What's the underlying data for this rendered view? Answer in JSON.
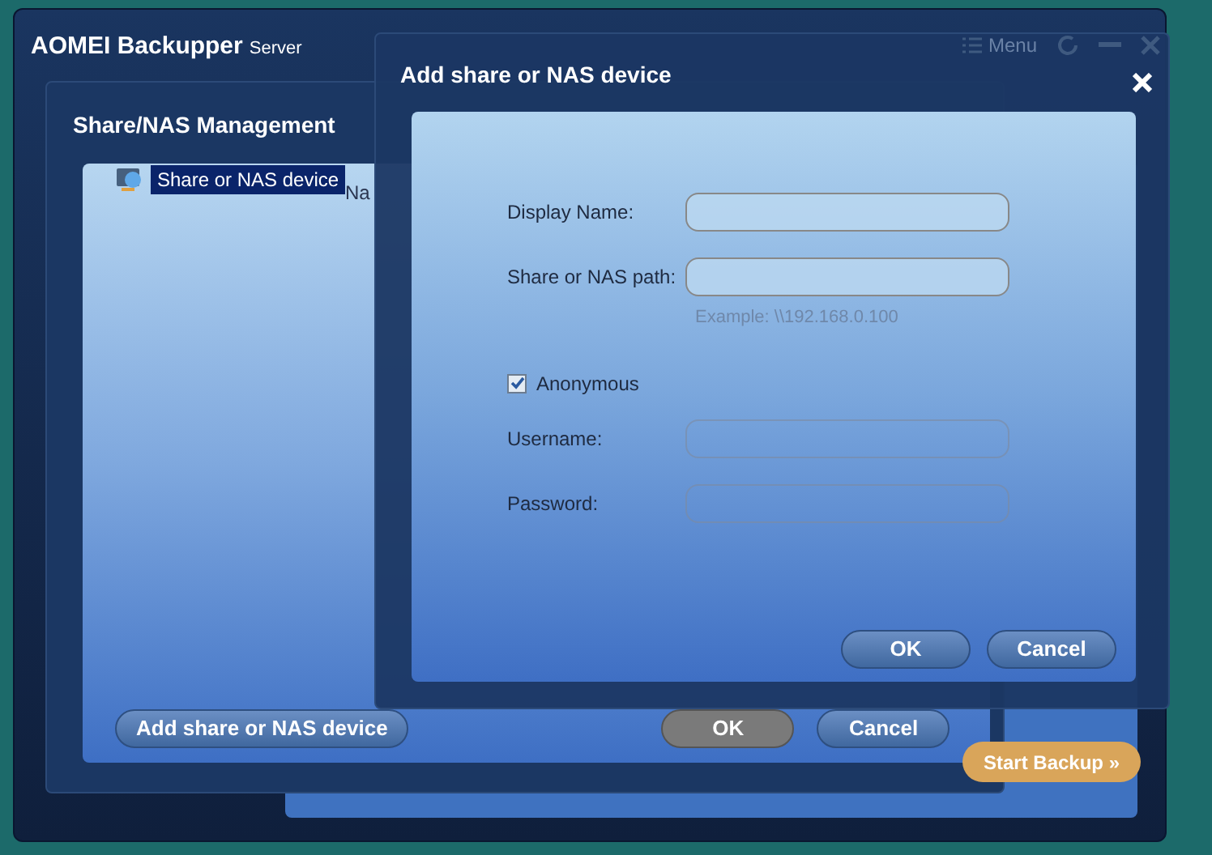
{
  "app": {
    "title": "AOMEI Backupper",
    "edition": "Server",
    "menu_label": "Menu"
  },
  "background": {
    "column_header": "Na",
    "start_button": "Start Backup »"
  },
  "management": {
    "title": "Share/NAS Management",
    "tree": [
      {
        "label": "Share or NAS device",
        "selected": true
      }
    ],
    "add_button": "Add share or NAS device",
    "buttons": [
      {
        "label": "OK",
        "disabled": true
      },
      {
        "label": "Cancel",
        "disabled": false
      }
    ]
  },
  "dialog": {
    "title": "Add share or NAS device",
    "rows": [
      {
        "kind": "field",
        "label": "Display Name:",
        "disabled": false
      },
      {
        "kind": "field",
        "label": "Share or NAS path:",
        "disabled": false,
        "hint": "Example: \\\\192.168.0.100"
      },
      {
        "kind": "checkbox",
        "label": "Anonymous",
        "checked": true
      },
      {
        "kind": "field",
        "label": "Username:",
        "disabled": true
      },
      {
        "kind": "field",
        "label": "Password:",
        "disabled": true
      }
    ],
    "buttons": [
      {
        "label": "OK"
      },
      {
        "label": "Cancel"
      }
    ]
  }
}
